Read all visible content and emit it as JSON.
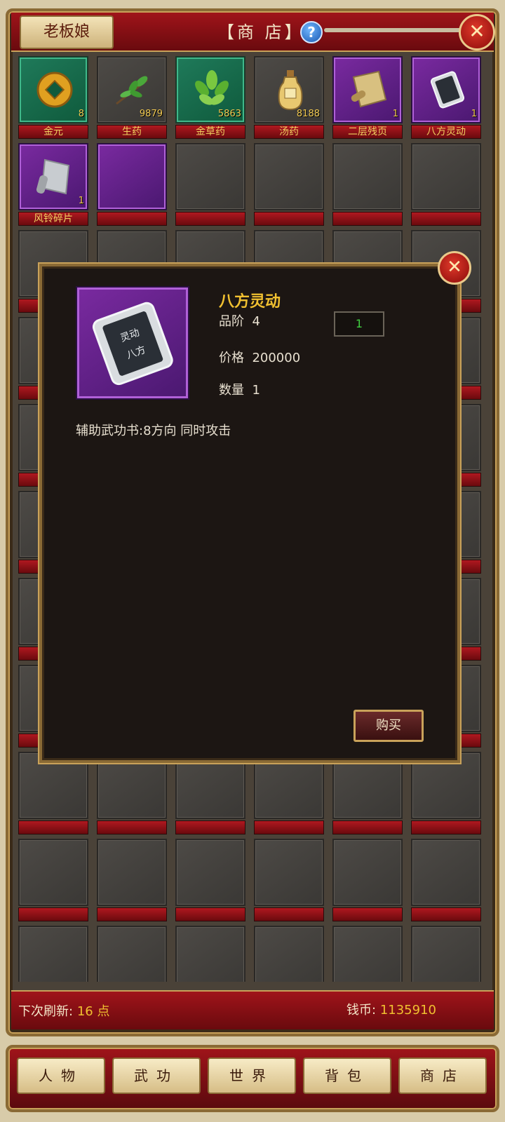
{
  "header": {
    "owner_tab": "老板娘",
    "title": "【商 店】",
    "help_glyph": "?",
    "close_glyph": "✕"
  },
  "items": [
    {
      "name": "金元",
      "count": "8",
      "rarity": "green",
      "icon": "gold-coin-icon"
    },
    {
      "name": "生药",
      "count": "9879",
      "rarity": "normal",
      "icon": "herb-icon"
    },
    {
      "name": "金草药",
      "count": "5863",
      "rarity": "green",
      "icon": "golden-herb-icon"
    },
    {
      "name": "汤药",
      "count": "8188",
      "rarity": "normal",
      "icon": "potion-bottle-icon"
    },
    {
      "name": "二层残页",
      "count": "1",
      "rarity": "purple",
      "icon": "scroll-icon"
    },
    {
      "name": "八方灵动",
      "count": "1",
      "rarity": "purple",
      "icon": "skill-book-icon"
    },
    {
      "name": "风铃碎片",
      "count": "1",
      "rarity": "purple",
      "icon": "fragment-scroll-icon"
    },
    {
      "name": "",
      "count": "",
      "rarity": "purple",
      "icon": ""
    }
  ],
  "detail": {
    "name": "八方灵动",
    "grade_label": "品阶",
    "grade": "4",
    "price_label": "价格",
    "price": "200000",
    "quantity_label": "数量",
    "quantity": "1",
    "quantity_input": "1",
    "description": "辅助武功书:8方向 同时攻击",
    "buy_label": "购买",
    "close_glyph": "✕"
  },
  "footer": {
    "refresh_label": "下次刷新:",
    "refresh_value": "16 点",
    "money_label": "钱币:",
    "money_value": "1135910"
  },
  "nav": [
    "人物",
    "武功",
    "世界",
    "背包",
    "商店"
  ]
}
